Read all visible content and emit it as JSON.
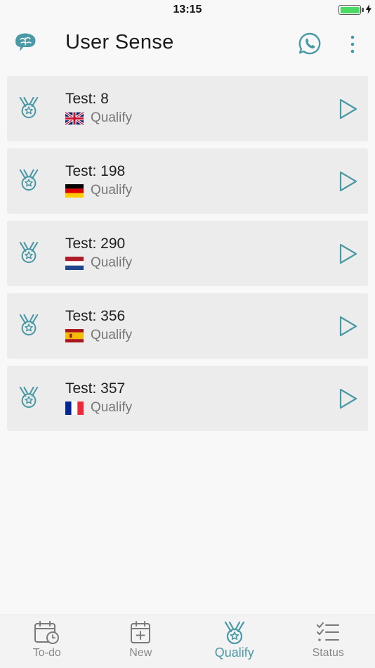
{
  "status_bar": {
    "time": "13:15",
    "battery_level": 1.0
  },
  "header": {
    "title": "User Sense",
    "logo_icon": "brain-chat-icon",
    "whatsapp_icon": "whatsapp-icon",
    "menu_icon": "more-vertical-icon"
  },
  "accent_color": "#4a99a6",
  "tests": [
    {
      "title": "Test: 8",
      "status": "Qualify",
      "flag": "gb"
    },
    {
      "title": "Test: 198",
      "status": "Qualify",
      "flag": "de"
    },
    {
      "title": "Test: 290",
      "status": "Qualify",
      "flag": "nl"
    },
    {
      "title": "Test: 356",
      "status": "Qualify",
      "flag": "es"
    },
    {
      "title": "Test: 357",
      "status": "Qualify",
      "flag": "fr"
    }
  ],
  "tabs": [
    {
      "label": "To-do",
      "icon": "calendar-clock-icon",
      "active": false
    },
    {
      "label": "New",
      "icon": "calendar-plus-icon",
      "active": false
    },
    {
      "label": "Qualify",
      "icon": "medal-icon",
      "active": true
    },
    {
      "label": "Status",
      "icon": "checklist-icon",
      "active": false
    }
  ]
}
